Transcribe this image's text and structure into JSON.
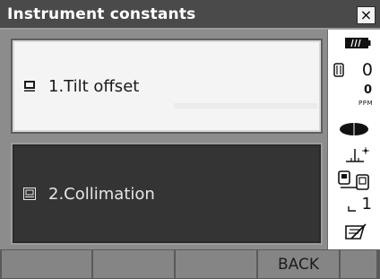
{
  "window": {
    "title": "Instrument constants",
    "close_symbol": "×"
  },
  "menu": {
    "items": [
      {
        "label": "1.Tilt offset",
        "icon": "menu-card-icon",
        "selected": false
      },
      {
        "label": "2.Collimation",
        "icon": "menu-card-icon",
        "selected": true
      }
    ]
  },
  "status": {
    "battery_icon": "battery-icon",
    "prism_constant": "0",
    "ppm_value": "0",
    "ppm_unit": "PPM",
    "target_icon": "target-ellipse-icon",
    "tilt_icon": "tilt-compensation-icon",
    "comm_icon": "communication-icon",
    "page_number": "1",
    "input_mode_icon": "input-mode-icon"
  },
  "softkeys": [
    "",
    "",
    "",
    "BACK",
    ""
  ],
  "colors": {
    "titlebar_bg": "#4a4a4a",
    "selected_item_bg": "#343434",
    "unselected_item_bg": "#f4f4f4",
    "softkey_bg": "#858585"
  }
}
